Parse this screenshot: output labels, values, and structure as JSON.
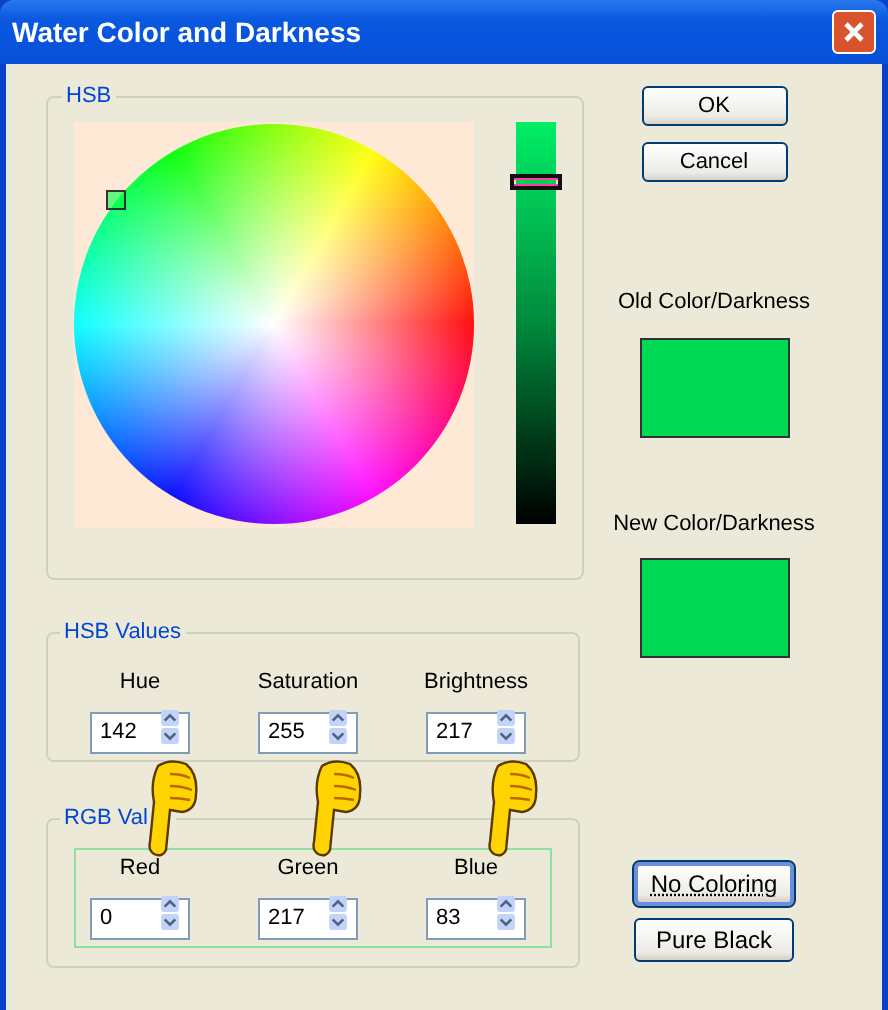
{
  "window": {
    "title": "Water Color and Darkness"
  },
  "hsb_group": {
    "label": "HSB",
    "brightness_slider": {
      "level": 0.85
    }
  },
  "buttons": [
    {
      "label": "OK"
    },
    {
      "label": "Cancel"
    }
  ],
  "old_color": {
    "label": "Old Color/Darkness",
    "color": "#00d953"
  },
  "new_color": {
    "label": "New Color/Darkness",
    "color": "#00d953"
  },
  "hsb_values": {
    "label": "HSB Values",
    "fields": [
      {
        "label": "Hue",
        "value": "142"
      },
      {
        "label": "Saturation",
        "value": "255"
      },
      {
        "label": "Brightness",
        "value": "217"
      }
    ]
  },
  "rgb_values": {
    "label": "RGB Val",
    "fields": [
      {
        "label": "Red",
        "value": "0"
      },
      {
        "label": "Green",
        "value": "217"
      },
      {
        "label": "Blue",
        "value": "83"
      }
    ]
  },
  "side_buttons": [
    {
      "label": "No Coloring",
      "focused": true
    },
    {
      "label": "Pure Black",
      "focused": false
    }
  ]
}
